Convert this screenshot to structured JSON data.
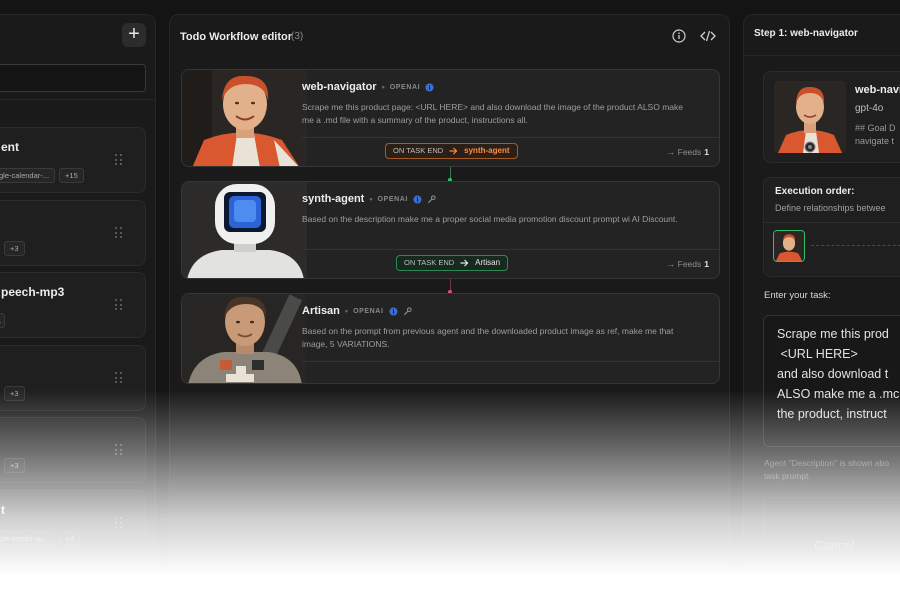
{
  "left_panel": {
    "add_label": "+",
    "cards": [
      {
        "title": "ent",
        "chips": [
          "gle-calendar-...",
          "+15"
        ]
      },
      {
        "title": "",
        "chips": [
          "",
          "+3"
        ]
      },
      {
        "title": "peech-mp3",
        "chips": [
          "1"
        ]
      },
      {
        "title": "",
        "chips": [
          "",
          "+3"
        ]
      },
      {
        "title": "",
        "chips": [
          "",
          "+3"
        ]
      },
      {
        "title": "t",
        "chips": [
          "gle-trends-qu...",
          "+4"
        ]
      }
    ]
  },
  "editor": {
    "title": "Todo Workflow editor",
    "count": "(3)",
    "agents": [
      {
        "name": "web-navigator",
        "provider": "OPENAI",
        "description": "Scrape me this product page: <URL HERE> and also download the image of the product ALSO make me a .md file with a summary of the product, instructions all.",
        "on_task_end_label": "ON TASK END",
        "on_task_end_target": "synth-agent",
        "feeds_label": "Feeds",
        "feeds_count": "1"
      },
      {
        "name": "synth-agent",
        "provider": "OPENAI",
        "description": "Based on the description make me a proper social media promotion discount prompt wi AI Discount.",
        "on_task_end_label": "ON TASK END",
        "on_task_end_target": "Artisan",
        "feeds_label": "Feeds",
        "feeds_count": "1"
      },
      {
        "name": "Artisan",
        "provider": "OPENAI",
        "description": "Based on the prompt from previous agent and the downloaded product image as ref, make me that image, 5 VARIATIONS."
      }
    ]
  },
  "step_panel": {
    "title": "Step 1: web-navigator",
    "agent_name": "web-navi",
    "model": "gpt-4o",
    "goal_lines": [
      "## Goal D",
      "navigate t"
    ],
    "execution_title": "Execution order:",
    "execution_sub": "Define relationships betwee",
    "task_label": "Enter your task:",
    "task_text": "Scrape me this prod\n <URL HERE>\nand also download t\nALSO make me a .mc\nthe product, instruct",
    "hint": "Agent \"Description\" is shown abo\ntask prompt.",
    "cancel_label": "Cancel"
  },
  "colors": {
    "accent_orange": "#ff8c42",
    "accent_green": "#2fbf6a",
    "accent_pink": "#e24a8a"
  }
}
